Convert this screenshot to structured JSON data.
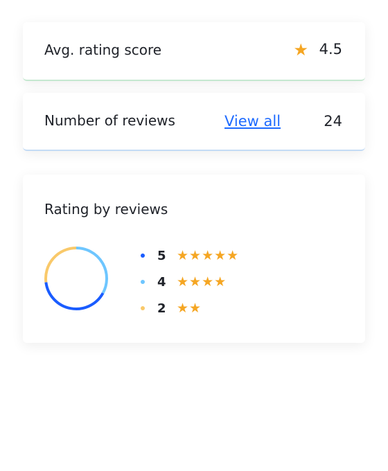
{
  "avg": {
    "label": "Avg. rating score",
    "value": "4.5",
    "icon": "star-icon"
  },
  "reviews": {
    "label": "Number of reviews",
    "link": "View all",
    "count": "24"
  },
  "rating": {
    "title": "Rating by reviews",
    "colors": {
      "star": "#f5a623",
      "link": "#1e6bff"
    },
    "items": [
      {
        "rating": "5",
        "stars": 5,
        "color": "#1a5cff",
        "share": 0.4
      },
      {
        "rating": "4",
        "stars": 4,
        "color": "#6ec6ff",
        "share": 0.33
      },
      {
        "rating": "2",
        "stars": 2,
        "color": "#f9c96a",
        "share": 0.27
      }
    ]
  }
}
